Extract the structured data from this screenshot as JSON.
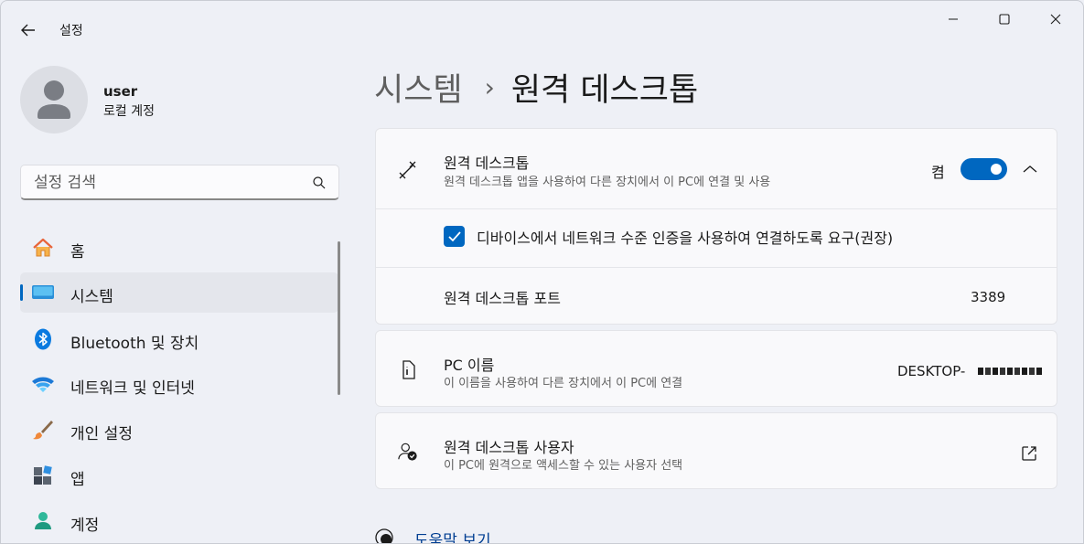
{
  "window": {
    "title": "설정",
    "minimize_icon": "minimize-icon",
    "maximize_icon": "maximize-icon",
    "close_icon": "close-icon"
  },
  "profile": {
    "name": "user",
    "account_type": "로컬 계정"
  },
  "search": {
    "placeholder": "설정 검색",
    "value": ""
  },
  "sidebar": {
    "items": [
      {
        "label": "홈",
        "icon": "home-icon",
        "active": false
      },
      {
        "label": "시스템",
        "icon": "system-monitor-icon",
        "active": true
      },
      {
        "label": "Bluetooth 및 장치",
        "icon": "bluetooth-icon",
        "active": false
      },
      {
        "label": "네트워크 및 인터넷",
        "icon": "wifi-icon",
        "active": false
      },
      {
        "label": "개인 설정",
        "icon": "paintbrush-icon",
        "active": false
      },
      {
        "label": "앱",
        "icon": "apps-icon",
        "active": false
      },
      {
        "label": "계정",
        "icon": "account-icon",
        "active": false
      }
    ]
  },
  "breadcrumb": {
    "parent": "시스템",
    "separator": "›",
    "current": "원격 데스크톱"
  },
  "remote_desktop": {
    "title": "원격 데스크톱",
    "subtitle": "원격 데스크톱 앱을 사용하여 다른 장치에서 이 PC에 연결 및 사용",
    "toggle_label": "켬",
    "toggle_on": true,
    "nla_checkbox_label": "디바이스에서 네트워크 수준 인증을 사용하여 연결하도록 요구(권장)",
    "nla_checked": true,
    "port_label": "원격 데스크톱 포트",
    "port_value": "3389"
  },
  "pc_name": {
    "title": "PC 이름",
    "subtitle": "이 이름을 사용하여 다른 장치에서 이 PC에 연결",
    "value": "DESKTOP-"
  },
  "remote_users": {
    "title": "원격 데스크톱 사용자",
    "subtitle": "이 PC에 원격으로 액세스할 수 있는 사용자 선택"
  },
  "help": {
    "label": "도움말 보기"
  },
  "colors": {
    "accent": "#0067c0",
    "background": "#eef0f6",
    "card": "#f9f9fb"
  }
}
